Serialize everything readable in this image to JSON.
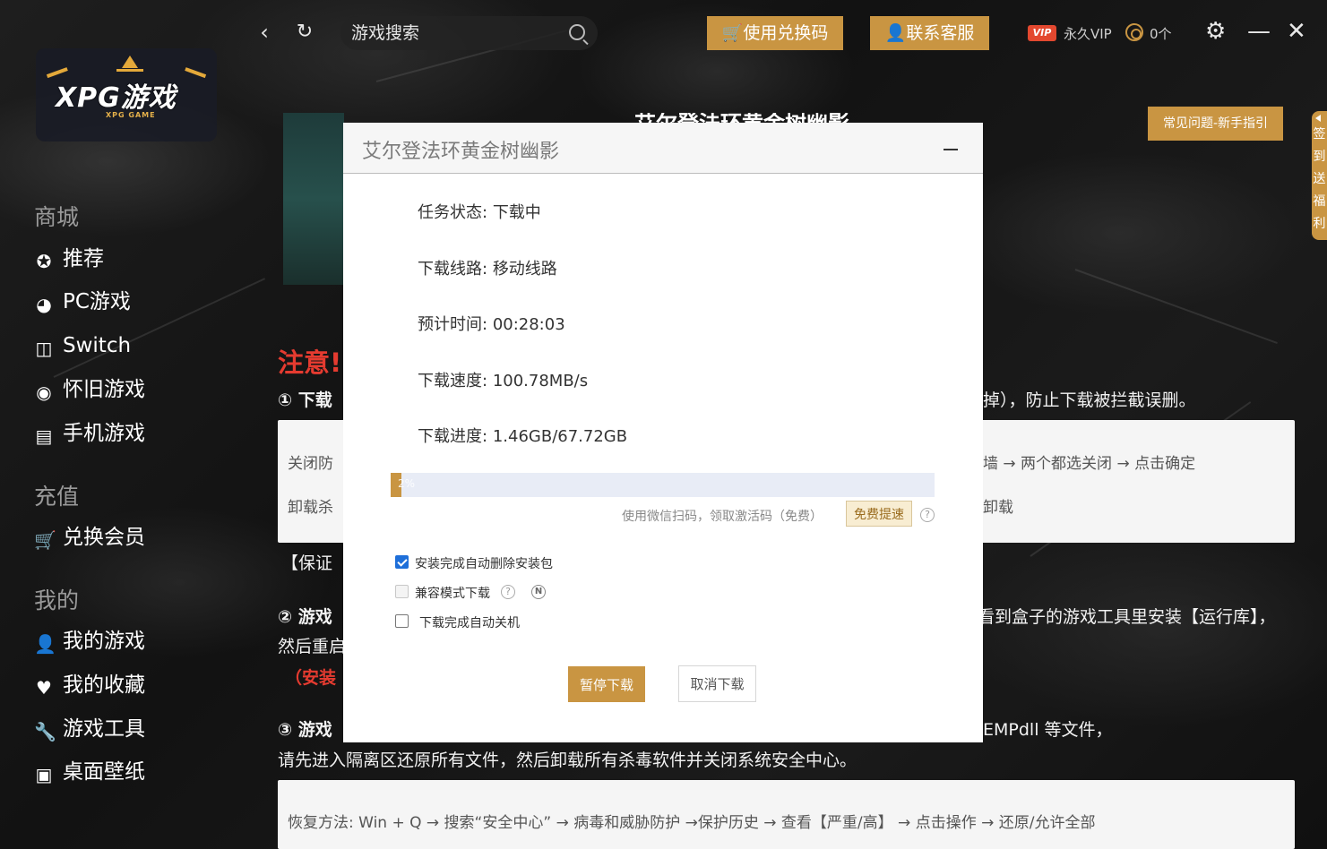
{
  "topbar": {
    "back_icon": "chevron-left-icon",
    "refresh_icon": "refresh-icon",
    "search_placeholder": "游戏搜索",
    "redeem_label": "🛒使用兑换码",
    "support_label": "👤联系客服",
    "vip_badge": "VIP",
    "vip_text": "永久VIP",
    "coins_text": "0个",
    "settings_icon": "gear-icon",
    "minimize_icon": "minimize-icon",
    "close_icon": "close-icon"
  },
  "logo": {
    "text": "XPG游戏",
    "sub": "XPG GAME"
  },
  "sidebar": {
    "section_store": "商城",
    "section_recharge": "充值",
    "section_mine": "我的",
    "store_items": [
      {
        "label": "推荐",
        "icon": "star-icon"
      },
      {
        "label": "PC游戏",
        "icon": "steam-icon"
      },
      {
        "label": "Switch",
        "icon": "switch-icon"
      },
      {
        "label": "怀旧游戏",
        "icon": "retro-icon"
      },
      {
        "label": "手机游戏",
        "icon": "phone-icon"
      }
    ],
    "recharge_items": [
      {
        "label": "兑换会员",
        "icon": "cart-icon"
      }
    ],
    "mine_items": [
      {
        "label": "我的游戏",
        "icon": "user-icon"
      },
      {
        "label": "我的收藏",
        "icon": "heart-icon"
      },
      {
        "label": "游戏工具",
        "icon": "wrench-icon"
      },
      {
        "label": "桌面壁纸",
        "icon": "image-icon"
      }
    ]
  },
  "page": {
    "faq_button": "常见问题-新手指引",
    "checkin_tab": "签到送福利",
    "notice_title": "注意!",
    "item1_head": "① 下载",
    "item1_tail": "掉），防止下载被拦截误删。",
    "box1_line1_start": "关闭防",
    "box1_line1_end": "墙 → 两个都选关闭 → 点击确定",
    "box1_line2_start": "卸载杀",
    "box1_line2_end": "卸载",
    "guarantee_start": "【保证",
    "item2_head": "② 游戏",
    "item2_tail": "看到盒子的游戏工具里安装【运行库】，",
    "item2_line2": "然后重启",
    "item2_red": "（安装",
    "item3_head": "③ 游戏",
    "item3_tail": "EMPdll 等文件，",
    "item3_line2": "请先进入隔离区还原所有文件，然后卸载所有杀毒软件并关闭系统安全中心。",
    "box2_line": "恢复方法: Win + Q → 搜索“安全中心” → 病毒和威胁防护 →保护历史 → 查看【严重/高】 → 点击操作 → 还原/允许全部"
  },
  "modal": {
    "title": "艾尔登法环黄金树幽影",
    "rows": [
      {
        "label": "任务状态:",
        "value": "下载中"
      },
      {
        "label": "下载线路:",
        "value": "移动线路"
      },
      {
        "label": "预计时间:",
        "value": "00:28:03"
      },
      {
        "label": "下载速度:",
        "value": "100.78MB/s"
      },
      {
        "label": "下载进度:",
        "value": "1.46GB/67.72GB"
      }
    ],
    "progress_percent": 2,
    "progress_label": "2%",
    "scan_text": "使用微信扫码，领取激活码（免费）",
    "speed_button": "免费提速",
    "help_glyph": "?",
    "options": [
      {
        "label": "安装完成自动删除安装包",
        "checked": true,
        "disabled": false
      },
      {
        "label": "兼容模式下载",
        "checked": false,
        "disabled": true
      },
      {
        "label": "下载完成自动关机",
        "checked": false,
        "disabled": false
      }
    ],
    "n_glyph": "N",
    "pause_button": "暂停下载",
    "cancel_button": "取消下载"
  }
}
